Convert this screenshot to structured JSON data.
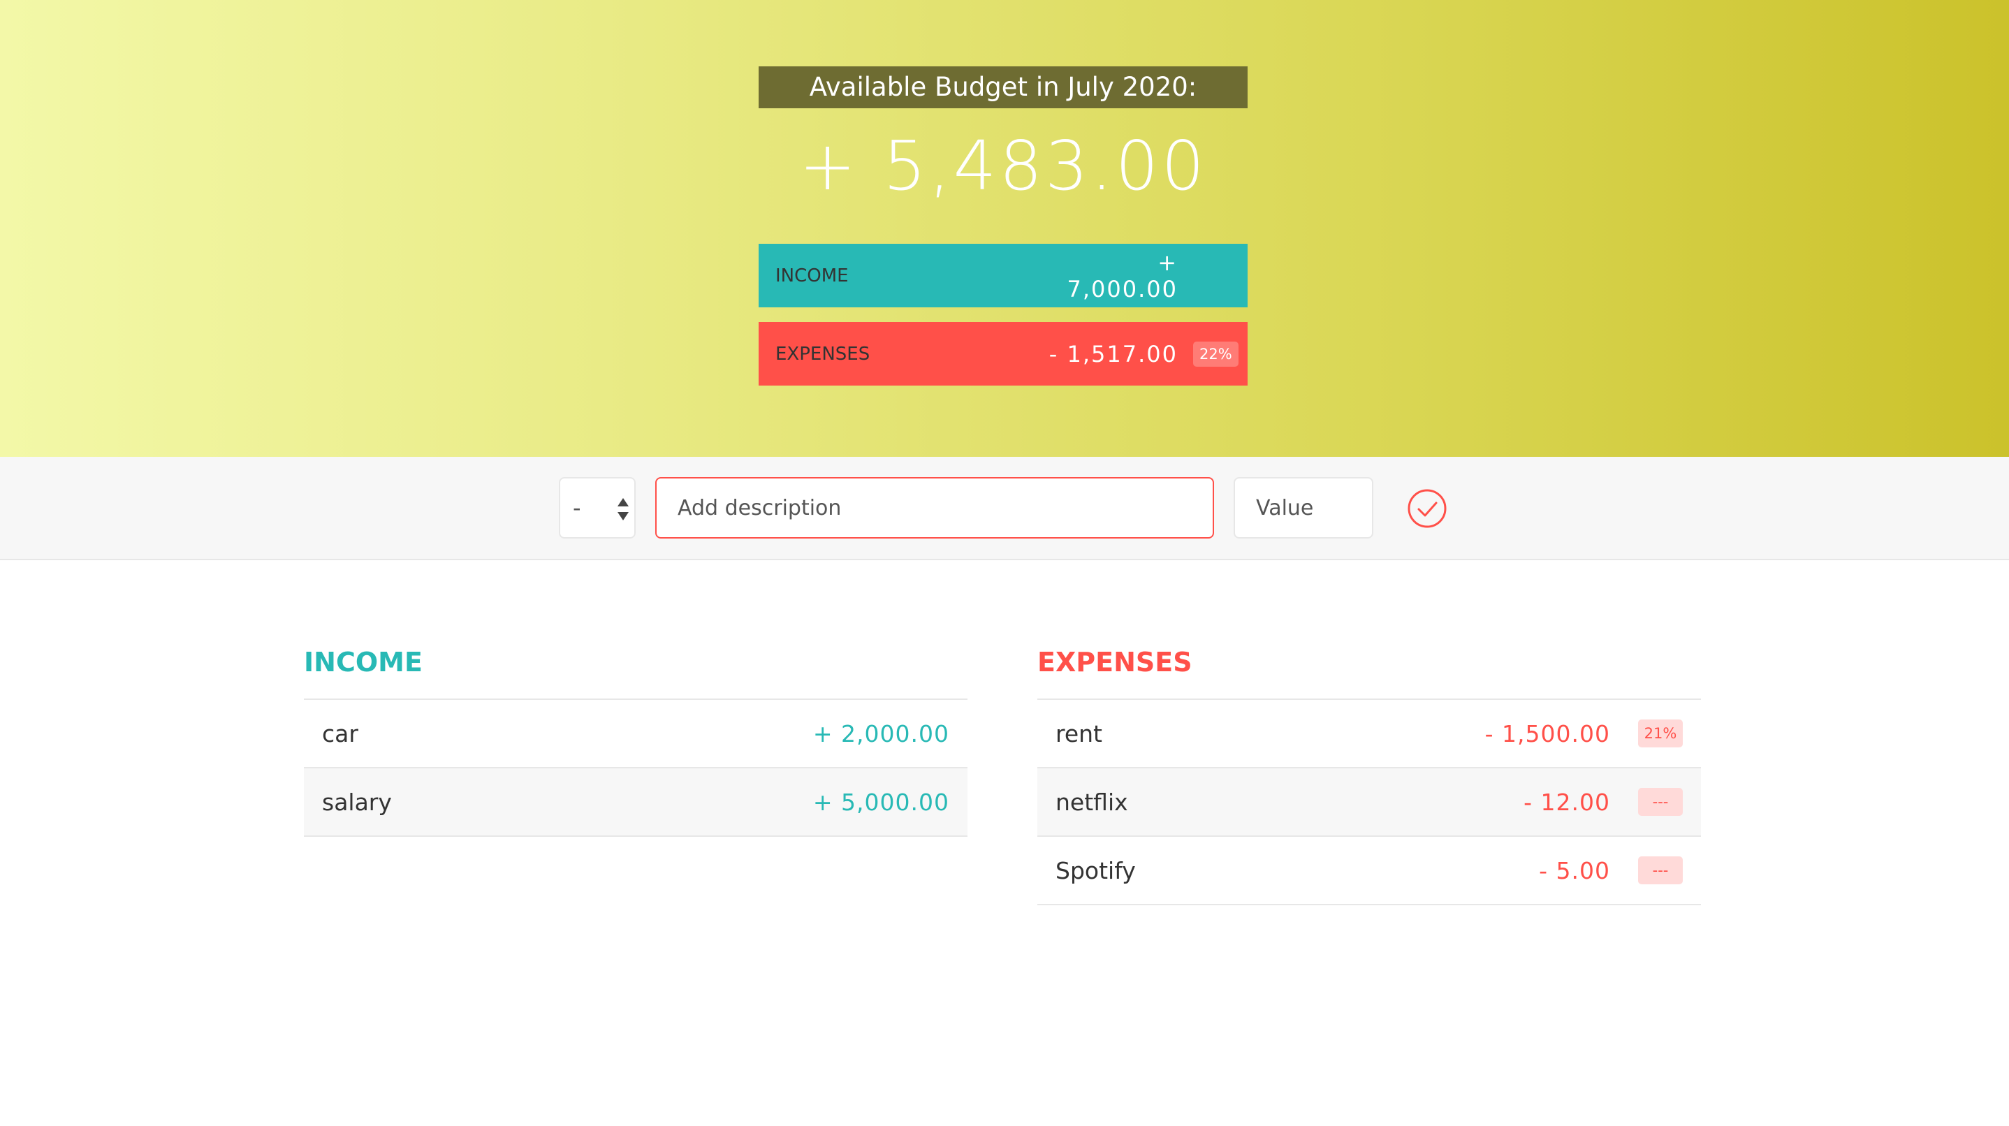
{
  "header": {
    "title": "Available Budget in July 2020:",
    "budget": "+ 5,483.00"
  },
  "summary": {
    "income": {
      "label": "Income",
      "value": "+ 7,000.00"
    },
    "expenses": {
      "label": "Expenses",
      "value": "- 1,517.00",
      "percent": "22%"
    }
  },
  "add_form": {
    "type_value": "-",
    "description_placeholder": "Add description",
    "value_placeholder": "Value",
    "submit_icon": "check-circle-icon"
  },
  "income_list": {
    "title": "Income",
    "items": [
      {
        "description": "car",
        "value": "+ 2,000.00"
      },
      {
        "description": "salary",
        "value": "+ 5,000.00"
      }
    ]
  },
  "expenses_list": {
    "title": "Expenses",
    "items": [
      {
        "description": "rent",
        "value": "- 1,500.00",
        "percent": "21%"
      },
      {
        "description": "netflix",
        "value": "- 12.00",
        "percent": "---"
      },
      {
        "description": "Spotify",
        "value": "- 5.00",
        "percent": "---"
      }
    ]
  },
  "colors": {
    "income": "#28b9b5",
    "expenses": "#ff5049",
    "title_bg": "#6e6c32"
  }
}
